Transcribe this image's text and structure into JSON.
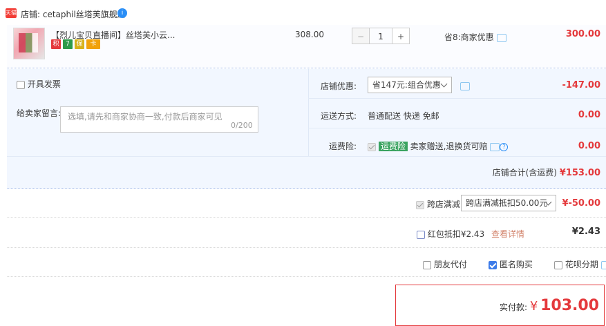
{
  "shop": {
    "tag": "天猫",
    "label": "店铺: cetaphil丝塔芙旗舰店",
    "badge": "i"
  },
  "item": {
    "title": "【烈儿宝贝直播间】丝塔芙小云...",
    "icons": [
      "积",
      "7",
      "保",
      "卡"
    ],
    "price": "308.00",
    "quantity": "1",
    "minus": "−",
    "plus": "+",
    "discount_text": "省8:商家优惠",
    "subtotal": "300.00"
  },
  "options": {
    "invoice_label": "开具发票",
    "message_label": "给卖家留言:",
    "message_placeholder": "选填,请先和商家协商一致,付款后商家可见",
    "message_count": "0/200",
    "shop_discount_label": "店铺优惠:",
    "shop_discount_select": "省147元:组合优惠",
    "shop_discount_value": "-147.00",
    "shipping_label": "运送方式:",
    "shipping_text": "普通配送 快递 免邮",
    "shipping_value": "0.00",
    "insurance_label": "运费险:",
    "insurance_tag": "运费险",
    "insurance_text": "卖家赠送,退换货可赔",
    "insurance_value": "0.00",
    "shop_total_label": "店铺合计(含运费)",
    "shop_total_value": "¥153.00"
  },
  "cross_store": {
    "label": "跨店满减",
    "select": "跨店满减抵扣50.00元",
    "value": "¥-50.00"
  },
  "red_packet": {
    "label": "红包抵扣¥2.43",
    "link": "查看详情",
    "value": "¥2.43"
  },
  "pay_options": {
    "friend": "朋友代付",
    "anonymous": "匿名购买",
    "installment": "花呗分期"
  },
  "payment": {
    "label": "实付款:",
    "currency": "¥",
    "amount": "103.00"
  },
  "colors": {
    "accent_red": "#e4393c",
    "blue": "#3c7be9",
    "panel": "#f2f7ff"
  }
}
